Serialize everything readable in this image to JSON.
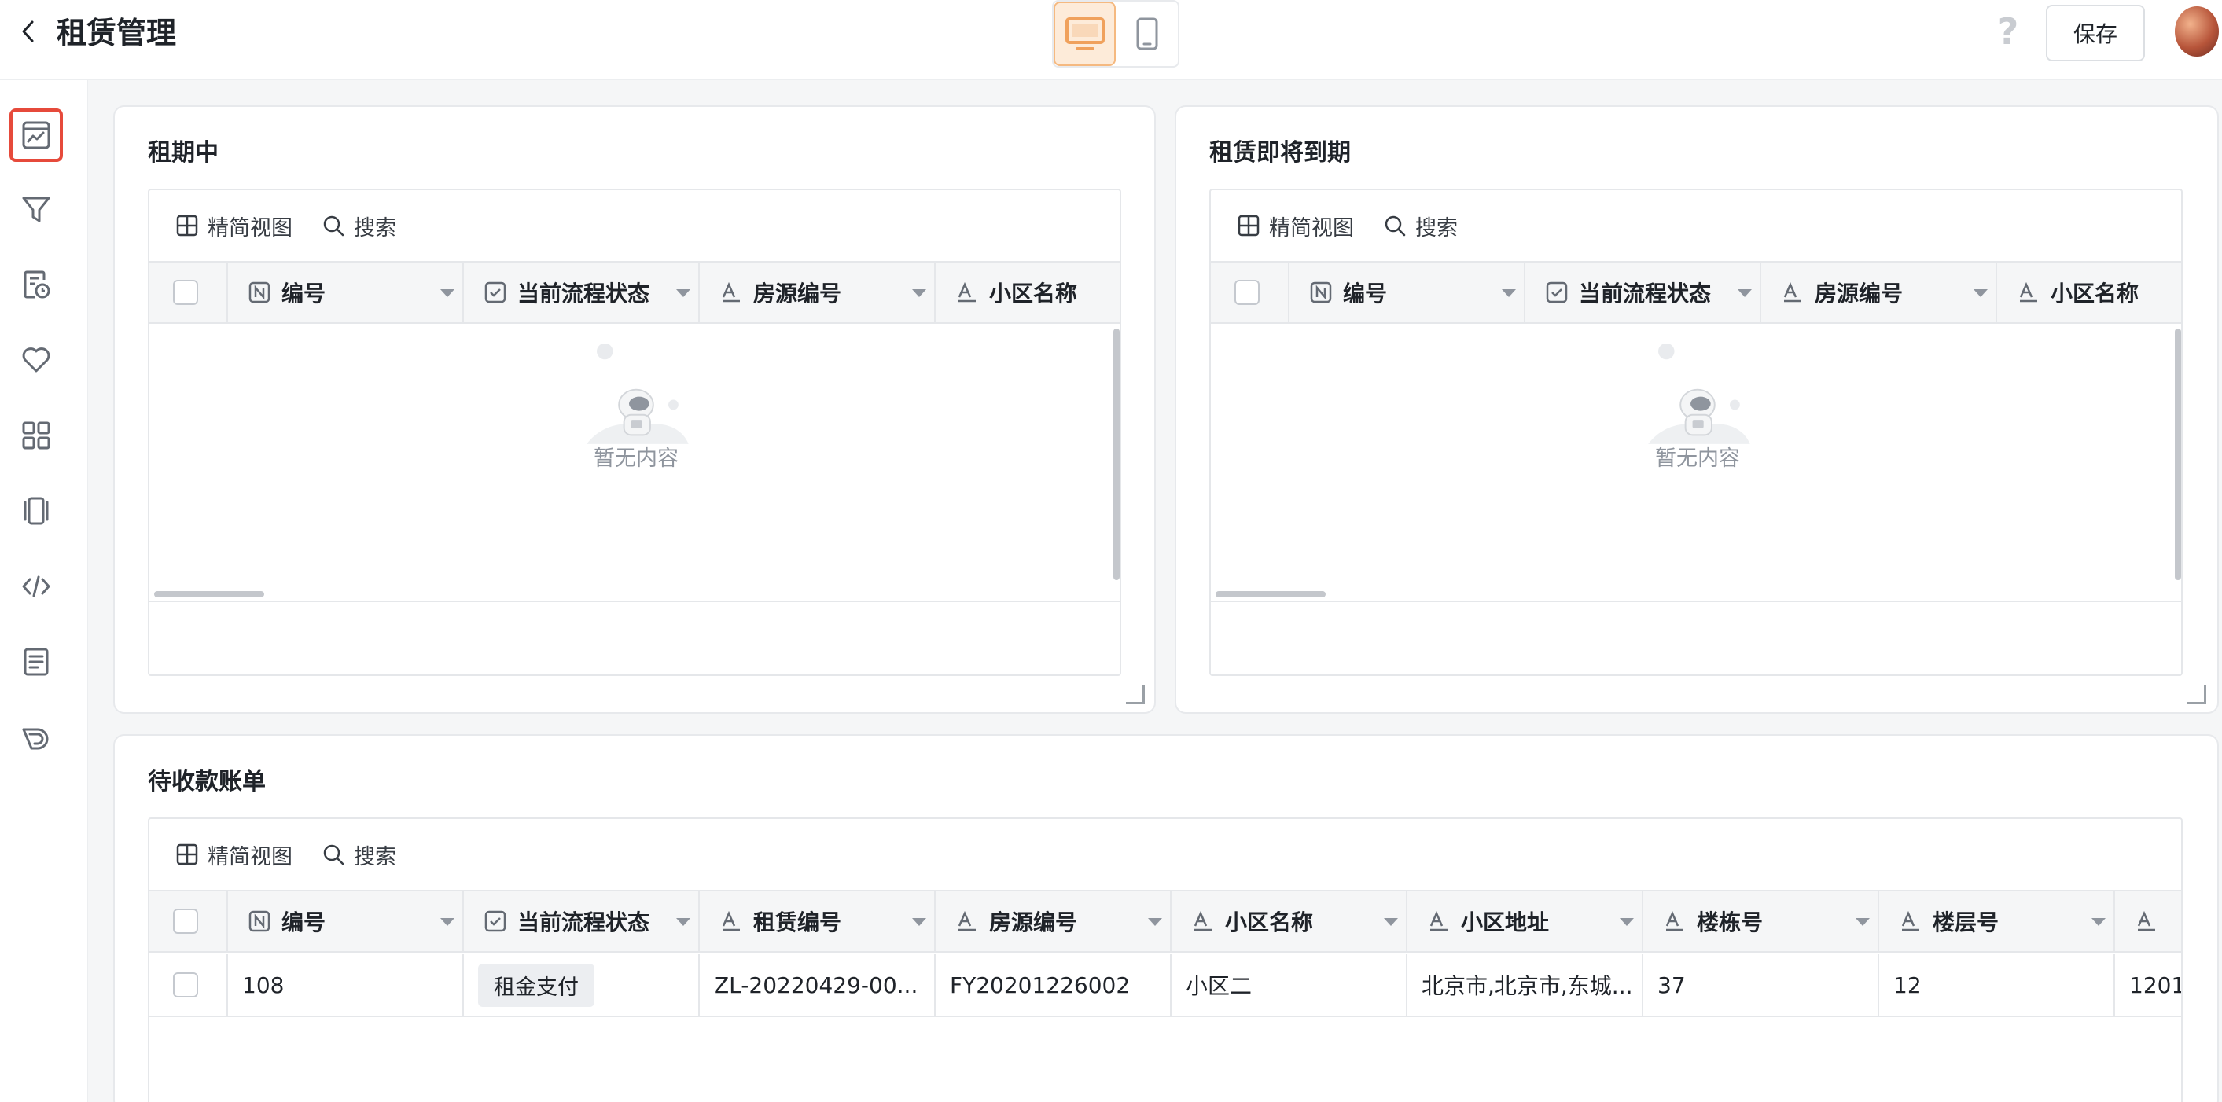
{
  "header": {
    "title": "租赁管理",
    "save_label": "保存",
    "help_label": "?"
  },
  "colors": {
    "accent": "#f0a15c",
    "active_outline": "#e64a3b",
    "muted_text": "#8f959e"
  },
  "sidebar": {
    "items": [
      {
        "name": "dashboard-icon",
        "active": true
      },
      {
        "name": "filter-icon"
      },
      {
        "name": "report-clock-icon"
      },
      {
        "name": "heart-icon"
      },
      {
        "name": "grid-icon"
      },
      {
        "name": "carousel-icon"
      },
      {
        "name": "code-icon"
      },
      {
        "name": "document-icon"
      },
      {
        "name": "layers-icon"
      }
    ]
  },
  "toolbar": {
    "compact_view_label": "精简视图",
    "search_label": "搜索"
  },
  "cards": {
    "in_lease": {
      "title": "租期中",
      "columns": [
        "编号",
        "当前流程状态",
        "房源编号",
        "小区名称"
      ],
      "empty_text": "暂无内容"
    },
    "expiring": {
      "title": "租赁即将到期",
      "columns": [
        "编号",
        "当前流程状态",
        "房源编号",
        "小区名称"
      ],
      "empty_text": "暂无内容"
    },
    "receivables": {
      "title": "待收款账单",
      "columns": [
        "编号",
        "当前流程状态",
        "租赁编号",
        "房源编号",
        "小区名称",
        "小区地址",
        "楼栋号",
        "楼层号",
        ""
      ],
      "rows": [
        {
          "id": "108",
          "status": "租金支付",
          "lease_no": "ZL-20220429-00...",
          "house_no": "FY20201226002",
          "community": "小区二",
          "address": "北京市,北京市,东城...",
          "building": "37",
          "floor": "12",
          "room": "1201"
        }
      ]
    }
  }
}
